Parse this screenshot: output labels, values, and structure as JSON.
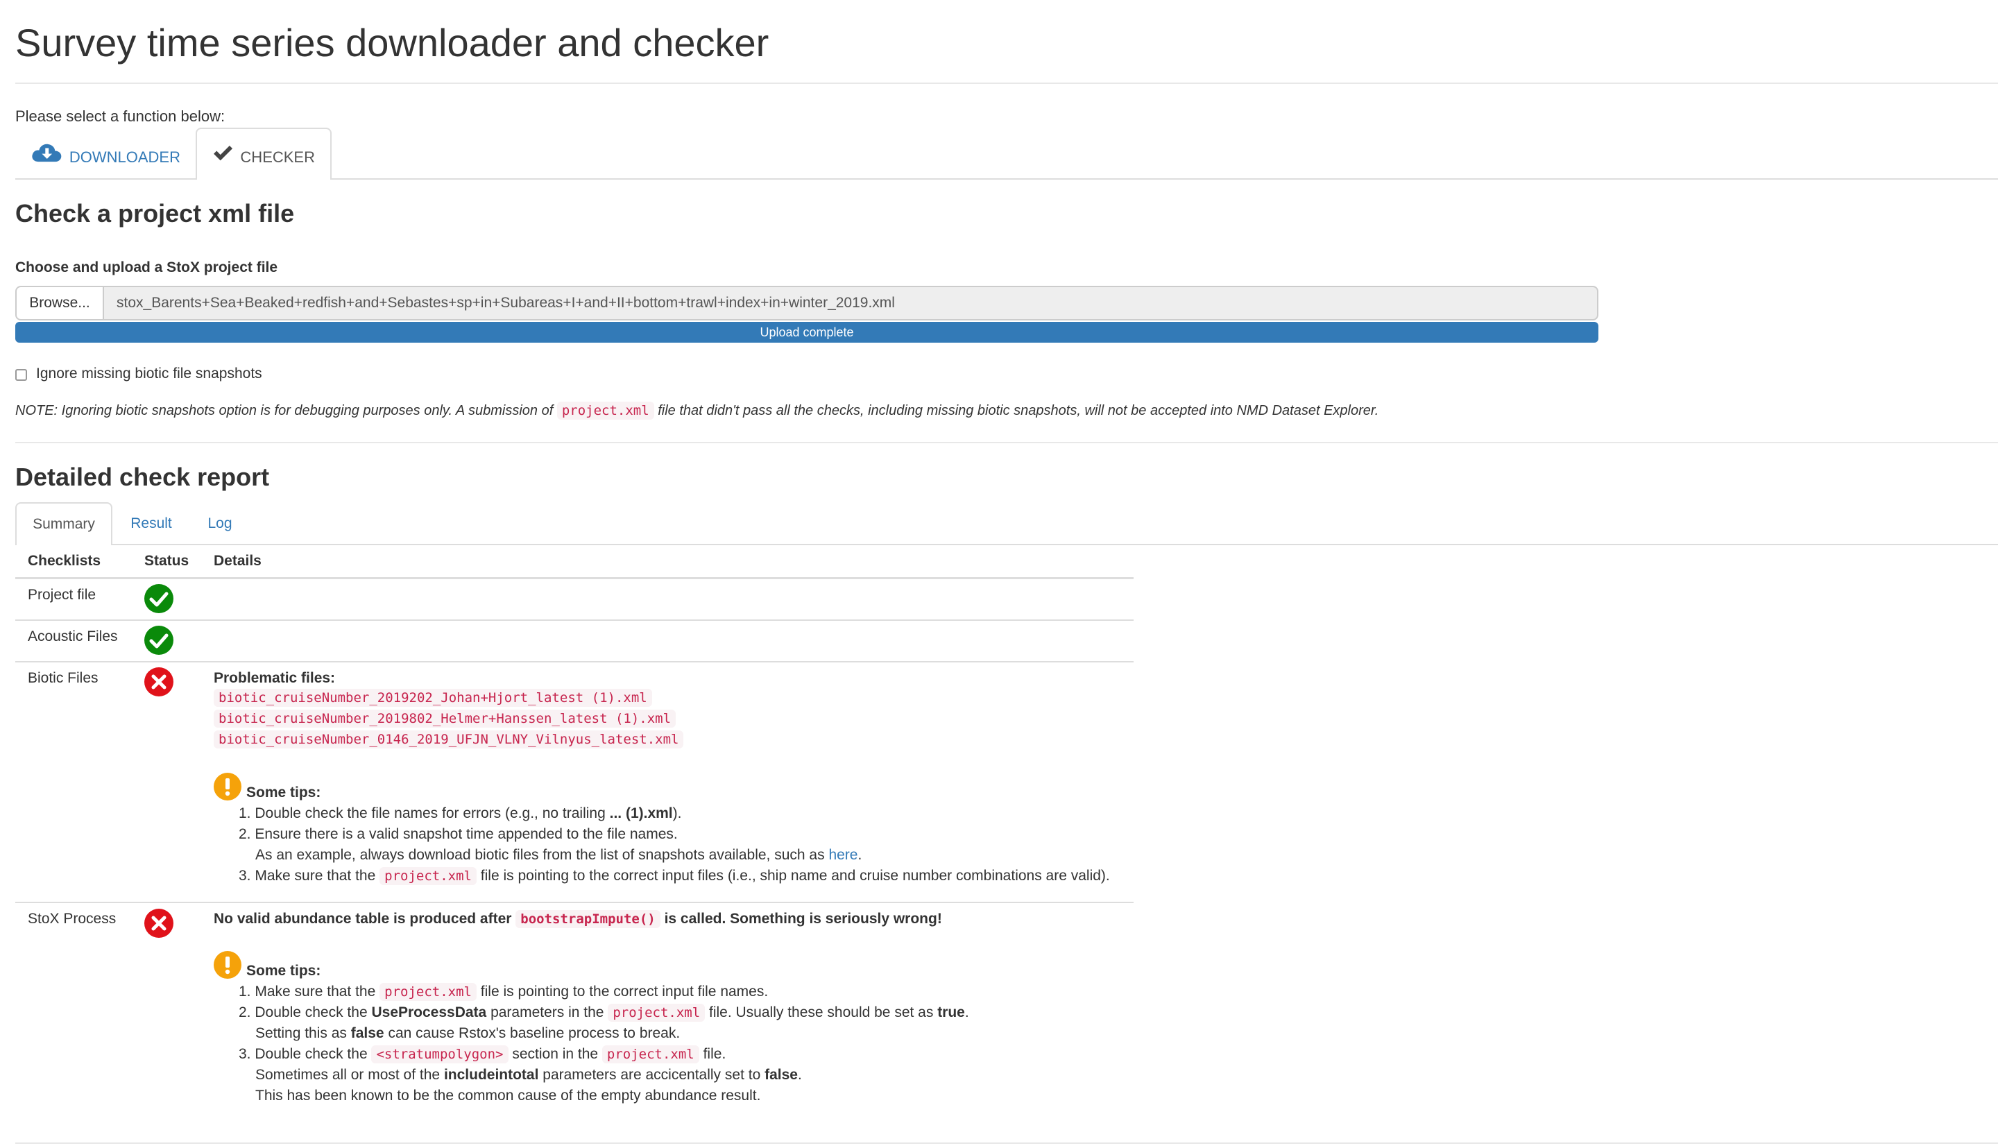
{
  "app": {
    "title": "Survey time series downloader and checker",
    "prompt": "Please select a function below:"
  },
  "main_tabs": [
    {
      "label": "DOWNLOADER",
      "icon": "cloud-download-icon",
      "active": false
    },
    {
      "label": "CHECKER",
      "icon": "checkmark-icon",
      "active": true
    }
  ],
  "checker": {
    "heading": "Check a project xml file",
    "upload_label": "Choose and upload a StoX project file",
    "browse_label": "Browse...",
    "file_name": "stox_Barents+Sea+Beaked+redfish+and+Sebastes+sp+in+Subareas+I+and+II+bottom+trawl+index+in+winter_2019.xml",
    "progress_text": "Upload complete",
    "progress": 1.0,
    "ignore_label": "Ignore missing biotic file snapshots",
    "ignore_checked": false,
    "note_before": "NOTE: Ignoring biotic snapshots option is for debugging purposes only. A submission of ",
    "note_code": "project.xml",
    "note_after": " file that didn't pass all the checks, including missing biotic snapshots, will not be accepted into NMD Dataset Explorer."
  },
  "report": {
    "heading": "Detailed check report",
    "tabs": [
      {
        "label": "Summary",
        "active": true
      },
      {
        "label": "Result",
        "active": false
      },
      {
        "label": "Log",
        "active": false
      }
    ],
    "columns": [
      "Checklists",
      "Status",
      "Details"
    ],
    "rows": [
      {
        "name": "Project file",
        "status": "ok"
      },
      {
        "name": "Acoustic Files",
        "status": "ok"
      },
      {
        "name": "Biotic Files",
        "status": "error",
        "problem_title": "Problematic files:",
        "files": [
          "biotic_cruiseNumber_2019202_Johan+Hjort_latest (1).xml",
          "biotic_cruiseNumber_2019802_Helmer+Hanssen_latest (1).xml",
          "biotic_cruiseNumber_0146_2019_UFJN_VLNY_Vilnyus_latest.xml"
        ],
        "tips_title": "Some tips:",
        "tips": {
          "t1_num": "1.",
          "t1_a": "Double check the file names for errors (e.g., no trailing ",
          "t1_b": "... (1).xml",
          "t1_c": ").",
          "t2_num": "2.",
          "t2_a": "Ensure there is a valid snapshot time appended to the file names.",
          "t2_b": "As an example, always download biotic files from the list of snapshots available, such as ",
          "t2_link": "here",
          "t2_c": ".",
          "t3_num": "3.",
          "t3_a": "Make sure that the ",
          "t3_code": "project.xml",
          "t3_b": " file is pointing to the correct input files (i.e., ship name and cruise number combinations are valid)."
        }
      },
      {
        "name": "StoX Process",
        "status": "error",
        "msg_a": "No valid abundance table is produced after ",
        "msg_code": "bootstrapImpute()",
        "msg_b": " is called. Something is seriously wrong!",
        "tips_title": "Some tips:",
        "tips": {
          "t1_num": "1.",
          "t1_a": "Make sure that the ",
          "t1_code": "project.xml",
          "t1_b": " file is pointing to the correct input file names.",
          "t2_num": "2.",
          "t2_a": "Double check the ",
          "t2_bold": "UseProcessData",
          "t2_b": " parameters in the ",
          "t2_code": "project.xml",
          "t2_c": " file. Usually these should be set as ",
          "t2_bold2": "true",
          "t2_d": ".",
          "t2_e": "Setting this as ",
          "t2_bold3": "false",
          "t2_f": " can cause Rstox's baseline process to break.",
          "t3_num": "3.",
          "t3_a": "Double check the ",
          "t3_code": "<stratumpolygon>",
          "t3_b": " section in the ",
          "t3_code2": "project.xml",
          "t3_c": " file.",
          "t3_d": "Sometimes all or most of the ",
          "t3_bold": "includeintotal",
          "t3_e": " parameters are accicentally set to ",
          "t3_bold2": "false",
          "t3_f": ".",
          "t3_g": "This has been known to be the common cause of the empty abundance result."
        }
      }
    ]
  },
  "colors": {
    "link": "#337ab7",
    "ok": "#0a8a0a",
    "error": "#e0121a",
    "warning": "#f5a20a",
    "code_text": "#c7254e",
    "code_bg": "#f9f2f4"
  }
}
